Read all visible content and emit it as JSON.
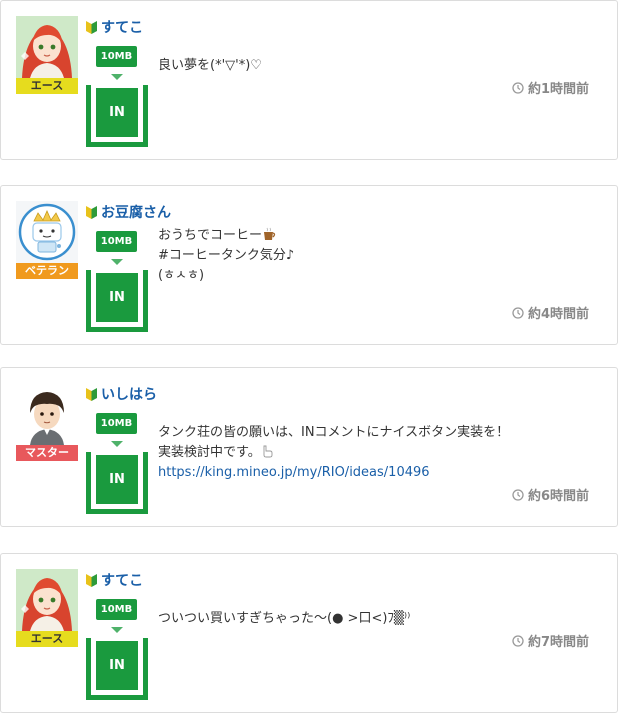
{
  "colors": {
    "accent_green": "#1a9a3e",
    "link_blue": "#1a5fa8",
    "rank_ace": "#e6dc1e",
    "rank_veteran": "#f09a1e",
    "rank_master": "#e8585c",
    "timestamp_gray": "#888888"
  },
  "posts": [
    {
      "username": "すてこ",
      "rank": "エース",
      "gift": "10MB",
      "tank_label": "IN",
      "lines": [
        "良い夢を(*'▽'*)♡"
      ],
      "link": "",
      "time": "約1時間前"
    },
    {
      "username": "お豆腐さん",
      "rank": "ベテラン",
      "gift": "10MB",
      "tank_label": "IN",
      "lines": [
        "おうちでコーヒー",
        "#コーヒータンク気分♪",
        "(ㅎㅅㅎ)"
      ],
      "link": "",
      "time": "約4時間前"
    },
    {
      "username": "いしはら",
      "rank": "マスター",
      "gift": "10MB",
      "tank_label": "IN",
      "lines": [
        "タンク荘の皆の願いは、INコメントにナイスボタン実装を！",
        "実装検討中です。"
      ],
      "link": "https://king.mineo.jp/my/RIO/ideas/10496",
      "time": "約6時間前"
    },
    {
      "username": "すてこ",
      "rank": "エース",
      "gift": "10MB",
      "tank_label": "IN",
      "lines": [
        "ついつい買いすぎちゃった〜(● >口<)ﾌ▒⁾⁾"
      ],
      "link": "",
      "time": "約7時間前"
    }
  ]
}
